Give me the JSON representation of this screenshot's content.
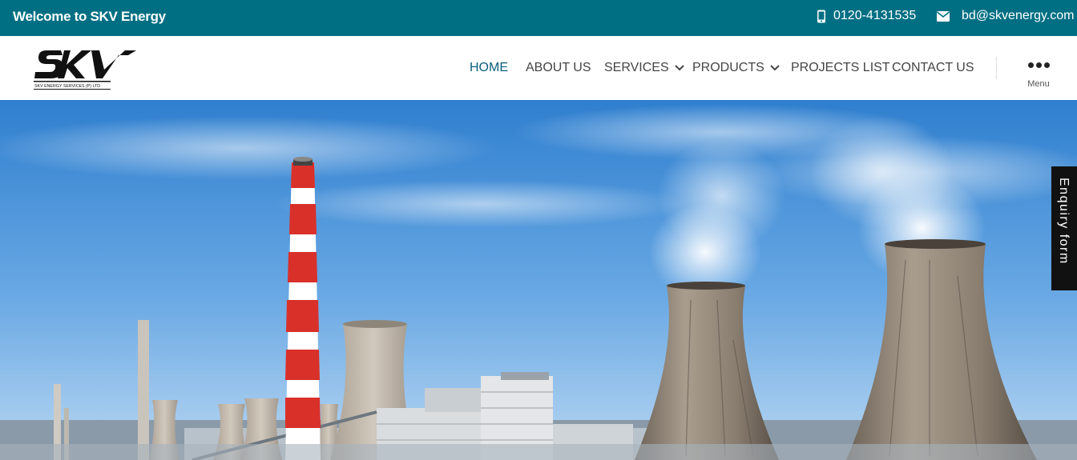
{
  "topbar": {
    "welcome": "Welcome to SKV Energy",
    "phone": "0120-4131535",
    "email": "bd@skvenergy.com"
  },
  "logo": {
    "text": "SKV",
    "tagline": "SKV ENERGY SERVICES (P) LTD"
  },
  "nav": {
    "items": [
      {
        "label": "HOME",
        "active": true
      },
      {
        "label": "ABOUT US"
      },
      {
        "label": "SERVICES",
        "dropdown": true
      },
      {
        "label": "PRODUCTS",
        "dropdown": true
      },
      {
        "label": "PROJECTS LIST"
      },
      {
        "label": "CONTACT US"
      }
    ],
    "menu_label": "Menu"
  },
  "enquiry_tab": "Enquiry form",
  "colors": {
    "topbar": "#006f83",
    "active_nav": "#0a5e7c",
    "enquiry_bg": "#111111"
  }
}
